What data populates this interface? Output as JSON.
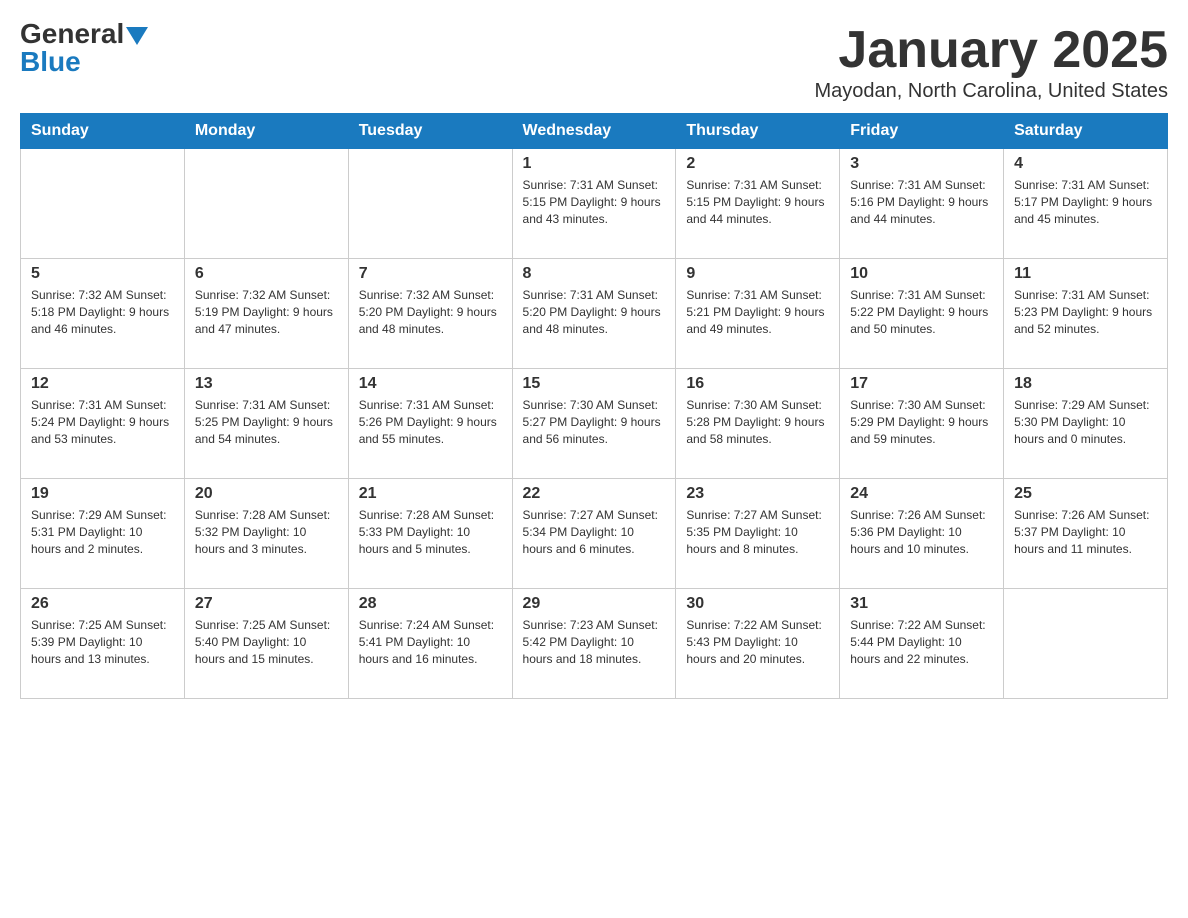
{
  "header": {
    "logo_general": "General",
    "logo_blue": "Blue",
    "title": "January 2025",
    "subtitle": "Mayodan, North Carolina, United States"
  },
  "calendar": {
    "days_of_week": [
      "Sunday",
      "Monday",
      "Tuesday",
      "Wednesday",
      "Thursday",
      "Friday",
      "Saturday"
    ],
    "weeks": [
      [
        {
          "day": "",
          "info": ""
        },
        {
          "day": "",
          "info": ""
        },
        {
          "day": "",
          "info": ""
        },
        {
          "day": "1",
          "info": "Sunrise: 7:31 AM\nSunset: 5:15 PM\nDaylight: 9 hours\nand 43 minutes."
        },
        {
          "day": "2",
          "info": "Sunrise: 7:31 AM\nSunset: 5:15 PM\nDaylight: 9 hours\nand 44 minutes."
        },
        {
          "day": "3",
          "info": "Sunrise: 7:31 AM\nSunset: 5:16 PM\nDaylight: 9 hours\nand 44 minutes."
        },
        {
          "day": "4",
          "info": "Sunrise: 7:31 AM\nSunset: 5:17 PM\nDaylight: 9 hours\nand 45 minutes."
        }
      ],
      [
        {
          "day": "5",
          "info": "Sunrise: 7:32 AM\nSunset: 5:18 PM\nDaylight: 9 hours\nand 46 minutes."
        },
        {
          "day": "6",
          "info": "Sunrise: 7:32 AM\nSunset: 5:19 PM\nDaylight: 9 hours\nand 47 minutes."
        },
        {
          "day": "7",
          "info": "Sunrise: 7:32 AM\nSunset: 5:20 PM\nDaylight: 9 hours\nand 48 minutes."
        },
        {
          "day": "8",
          "info": "Sunrise: 7:31 AM\nSunset: 5:20 PM\nDaylight: 9 hours\nand 48 minutes."
        },
        {
          "day": "9",
          "info": "Sunrise: 7:31 AM\nSunset: 5:21 PM\nDaylight: 9 hours\nand 49 minutes."
        },
        {
          "day": "10",
          "info": "Sunrise: 7:31 AM\nSunset: 5:22 PM\nDaylight: 9 hours\nand 50 minutes."
        },
        {
          "day": "11",
          "info": "Sunrise: 7:31 AM\nSunset: 5:23 PM\nDaylight: 9 hours\nand 52 minutes."
        }
      ],
      [
        {
          "day": "12",
          "info": "Sunrise: 7:31 AM\nSunset: 5:24 PM\nDaylight: 9 hours\nand 53 minutes."
        },
        {
          "day": "13",
          "info": "Sunrise: 7:31 AM\nSunset: 5:25 PM\nDaylight: 9 hours\nand 54 minutes."
        },
        {
          "day": "14",
          "info": "Sunrise: 7:31 AM\nSunset: 5:26 PM\nDaylight: 9 hours\nand 55 minutes."
        },
        {
          "day": "15",
          "info": "Sunrise: 7:30 AM\nSunset: 5:27 PM\nDaylight: 9 hours\nand 56 minutes."
        },
        {
          "day": "16",
          "info": "Sunrise: 7:30 AM\nSunset: 5:28 PM\nDaylight: 9 hours\nand 58 minutes."
        },
        {
          "day": "17",
          "info": "Sunrise: 7:30 AM\nSunset: 5:29 PM\nDaylight: 9 hours\nand 59 minutes."
        },
        {
          "day": "18",
          "info": "Sunrise: 7:29 AM\nSunset: 5:30 PM\nDaylight: 10 hours\nand 0 minutes."
        }
      ],
      [
        {
          "day": "19",
          "info": "Sunrise: 7:29 AM\nSunset: 5:31 PM\nDaylight: 10 hours\nand 2 minutes."
        },
        {
          "day": "20",
          "info": "Sunrise: 7:28 AM\nSunset: 5:32 PM\nDaylight: 10 hours\nand 3 minutes."
        },
        {
          "day": "21",
          "info": "Sunrise: 7:28 AM\nSunset: 5:33 PM\nDaylight: 10 hours\nand 5 minutes."
        },
        {
          "day": "22",
          "info": "Sunrise: 7:27 AM\nSunset: 5:34 PM\nDaylight: 10 hours\nand 6 minutes."
        },
        {
          "day": "23",
          "info": "Sunrise: 7:27 AM\nSunset: 5:35 PM\nDaylight: 10 hours\nand 8 minutes."
        },
        {
          "day": "24",
          "info": "Sunrise: 7:26 AM\nSunset: 5:36 PM\nDaylight: 10 hours\nand 10 minutes."
        },
        {
          "day": "25",
          "info": "Sunrise: 7:26 AM\nSunset: 5:37 PM\nDaylight: 10 hours\nand 11 minutes."
        }
      ],
      [
        {
          "day": "26",
          "info": "Sunrise: 7:25 AM\nSunset: 5:39 PM\nDaylight: 10 hours\nand 13 minutes."
        },
        {
          "day": "27",
          "info": "Sunrise: 7:25 AM\nSunset: 5:40 PM\nDaylight: 10 hours\nand 15 minutes."
        },
        {
          "day": "28",
          "info": "Sunrise: 7:24 AM\nSunset: 5:41 PM\nDaylight: 10 hours\nand 16 minutes."
        },
        {
          "day": "29",
          "info": "Sunrise: 7:23 AM\nSunset: 5:42 PM\nDaylight: 10 hours\nand 18 minutes."
        },
        {
          "day": "30",
          "info": "Sunrise: 7:22 AM\nSunset: 5:43 PM\nDaylight: 10 hours\nand 20 minutes."
        },
        {
          "day": "31",
          "info": "Sunrise: 7:22 AM\nSunset: 5:44 PM\nDaylight: 10 hours\nand 22 minutes."
        },
        {
          "day": "",
          "info": ""
        }
      ]
    ]
  }
}
